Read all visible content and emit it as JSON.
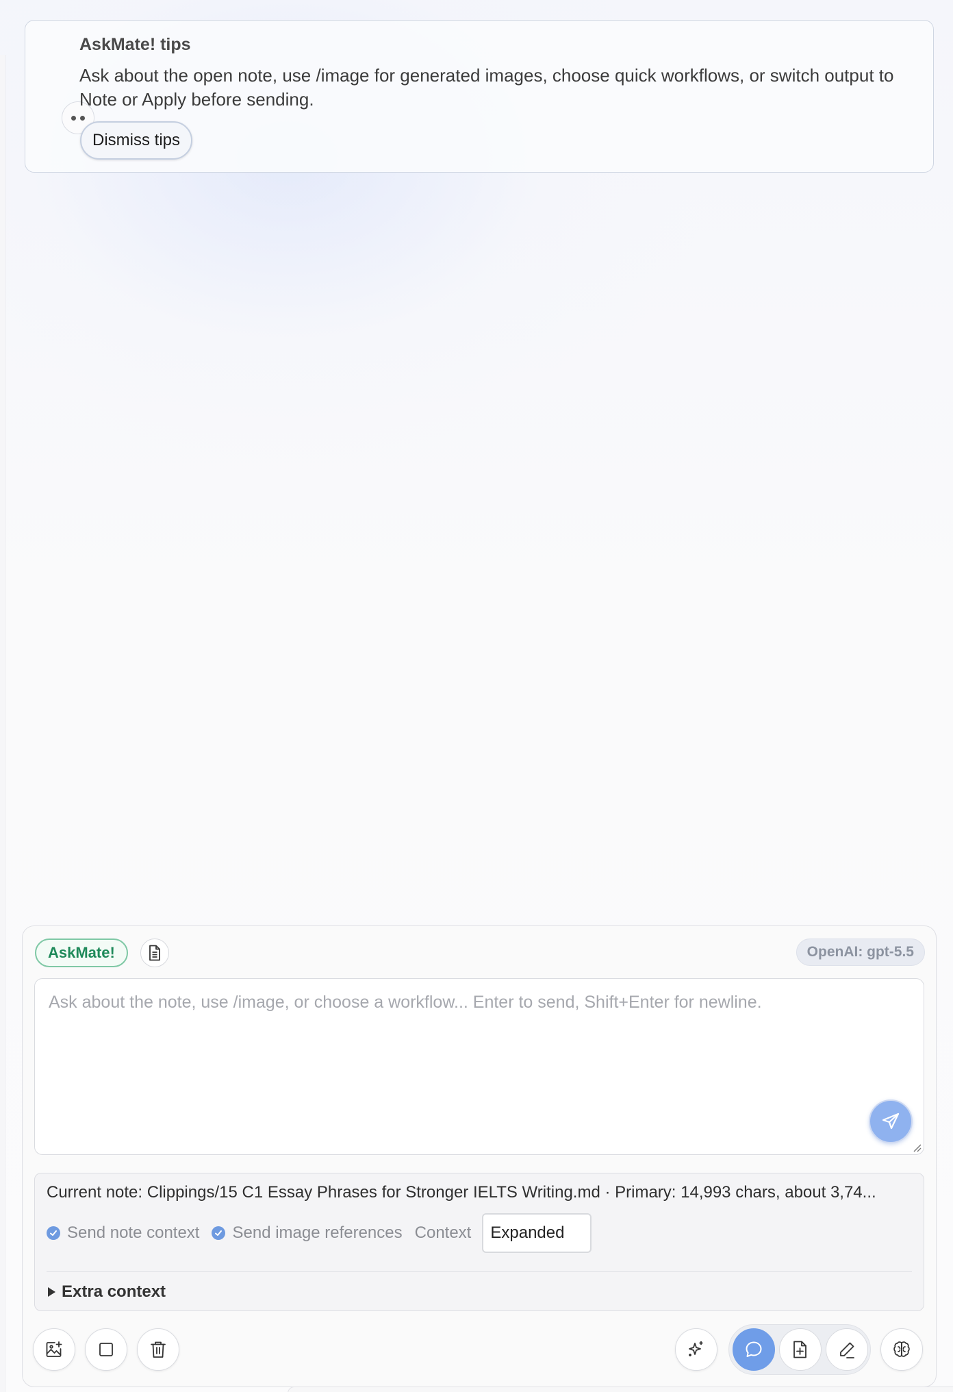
{
  "tips": {
    "title": "AskMate! tips",
    "body": "Ask about the open note, use /image for generated images, choose quick workflows, or switch output to Note or Apply before sending.",
    "dismiss_label": "Dismiss tips",
    "avatar_icon": "dots-icon"
  },
  "composer": {
    "brand_label": "AskMate!",
    "doc_icon": "document-icon",
    "model_label": "OpenAI: gpt-5.5",
    "prompt_placeholder": "Ask about the note, use /image, or choose a workflow... Enter to send, Shift+Enter for newline.",
    "prompt_value": "",
    "send_icon": "send-icon"
  },
  "context": {
    "current_note": "Current note: Clippings/15 C1 Essay Phrases for Stronger IELTS Writing.md · Primary: 14,993 chars, about 3,74...",
    "send_note_context_label": "Send note context",
    "send_note_context_checked": true,
    "send_image_refs_label": "Send image references",
    "send_image_refs_checked": true,
    "context_label": "Context",
    "context_value": "Expanded",
    "extra_context_label": "Extra context"
  },
  "toolbar": {
    "left_icons": [
      "image-add-icon",
      "square-icon",
      "trash-icon"
    ],
    "sparkle_icon": "sparkle-icon",
    "mode_icons": [
      "chat-bubble-icon",
      "note-add-icon",
      "pencil-icon"
    ],
    "active_mode": "chat",
    "brain_icon": "brain-icon"
  },
  "colors": {
    "accent_blue": "#6f9de8",
    "brand_green": "#1f8a5a",
    "brand_green_border": "#7fc8a5"
  }
}
